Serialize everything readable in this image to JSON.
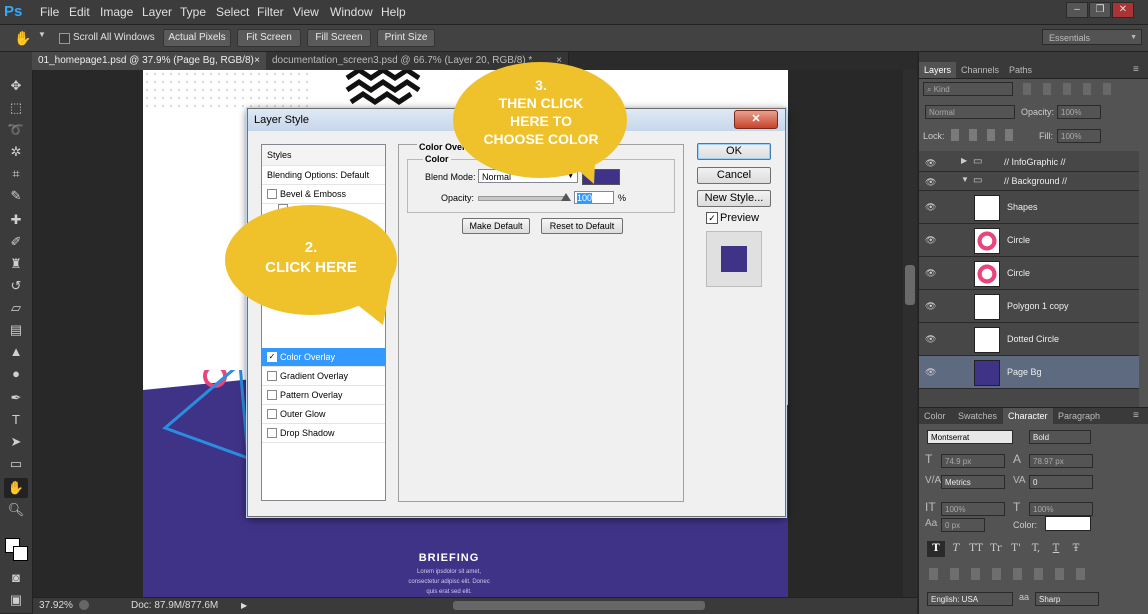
{
  "app": {
    "logo": "Ps"
  },
  "menu": [
    "File",
    "Edit",
    "Image",
    "Layer",
    "Type",
    "Select",
    "Filter",
    "View",
    "Window",
    "Help"
  ],
  "window_controls": [
    "–",
    "❐",
    "✕"
  ],
  "options_bar": {
    "scroll_all_windows": "Scroll All Windows",
    "buttons": [
      "Actual Pixels",
      "Fit Screen",
      "Fill Screen",
      "Print Size"
    ],
    "workspace": "Essentials"
  },
  "tabs": [
    {
      "label": "01_homepage1.psd @ 37.9% (Page Bg, RGB/8)",
      "close": "×"
    },
    {
      "label": "documentation_screen3.psd @ 66.7% (Layer 20, RGB/8) *",
      "close": "×"
    }
  ],
  "status": {
    "zoom": "37.92%",
    "doc": "Doc: 87.9M/877.6M"
  },
  "artboard": {
    "heading": "BRIEFING",
    "body_line1": "Lorem ipsdolor sit amet,",
    "body_line2": "consectetur adipisc elit. Donec",
    "body_line3": "quis erat sed elit."
  },
  "dialog": {
    "title": "Layer Style",
    "close": "✕",
    "styles_header": "Styles",
    "blending": "Blending Options: Default",
    "style_items": [
      {
        "label": "Bevel & Emboss",
        "checked": false
      },
      {
        "label": "Color Overlay",
        "checked": true
      },
      {
        "label": "Gradient Overlay",
        "checked": false
      },
      {
        "label": "Pattern Overlay",
        "checked": false
      },
      {
        "label": "Outer Glow",
        "checked": false
      },
      {
        "label": "Drop Shadow",
        "checked": false
      }
    ],
    "check_mark": "✓",
    "section_title": "Color Overlay",
    "group_title": "Color",
    "blend_mode_label": "Blend Mode:",
    "blend_mode_value": "Normal",
    "overlay_color": "#3f3388",
    "opacity_label": "Opacity:",
    "opacity_value": "100",
    "opacity_unit": "%",
    "opacity_level": 1.0,
    "make_default": "Make Default",
    "reset_default": "Reset to Default",
    "ok": "OK",
    "cancel": "Cancel",
    "new_style": "New Style...",
    "preview_label": "Preview",
    "preview_checked": true
  },
  "callouts": [
    {
      "number": "2.",
      "text": "CLICK HERE"
    },
    {
      "number": "3.",
      "line1": "THEN CLICK",
      "line2": "HERE TO",
      "line3": "CHOOSE COLOR"
    }
  ],
  "layers_panel": {
    "tabs": [
      "Layers",
      "Channels",
      "Paths"
    ],
    "kind": "Kind",
    "blend": "Normal",
    "opacity_label": "Opacity:",
    "opacity": "100%",
    "lock_label": "Lock:",
    "fill_label": "Fill:",
    "fill": "100%",
    "groups": [
      "// InfoGraphic //",
      "// Background //"
    ],
    "layers": [
      "Shapes",
      "Circle",
      "Circle",
      "Polygon 1 copy",
      "Dotted Circle",
      "Page Bg"
    ],
    "selected": "Page Bg"
  },
  "character_panel": {
    "tabs": [
      "Color",
      "Swatches",
      "Character",
      "Paragraph"
    ],
    "font_family": "Montserrat",
    "font_style": "Bold",
    "size": "74.9 px",
    "leading": "78.97 px",
    "kerning": "Metrics",
    "tracking": "0",
    "vscale": "100%",
    "hscale": "100%",
    "baseline": "0 px",
    "color_label": "Color:",
    "language": "English: USA",
    "antialias": "Sharp",
    "style_buttons": [
      "T",
      "T",
      "TT",
      "Tr",
      "T'",
      "T,",
      "T",
      "Ŧ"
    ]
  },
  "colors": {
    "accent": "#3f3388",
    "bubble": "#efc12b",
    "pink": "#e9457d",
    "blue": "#2a8ee0"
  }
}
